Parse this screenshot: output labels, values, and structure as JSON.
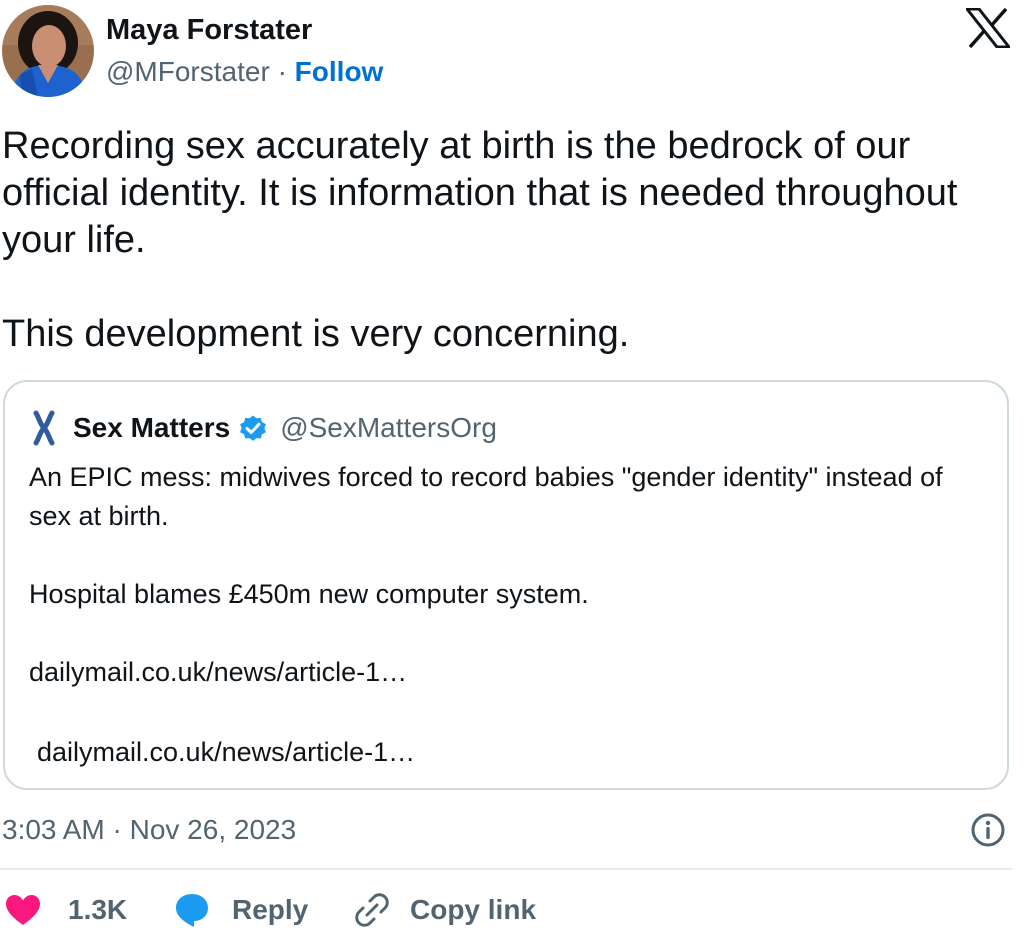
{
  "author": {
    "name": "Maya Forstater",
    "handle": "@MForstater",
    "separator": "·",
    "follow_label": "Follow"
  },
  "tweet": {
    "paragraphs": [
      "Recording sex accurately at birth is the bedrock of our official identity. It is information that is needed throughout your life.",
      "This development is very concerning."
    ]
  },
  "quoted_tweet": {
    "name": "Sex Matters",
    "handle": "@SexMattersOrg",
    "verified": true,
    "paragraphs": [
      "An EPIC mess: midwives forced to record babies \"gender identity\" instead of sex at birth.",
      "Hospital blames £450m new computer system.",
      "dailymail.co.uk/news/article-1…"
    ],
    "link_preview": "dailymail.co.uk/news/article-1…"
  },
  "timestamp": "3:03 AM · Nov 26, 2023",
  "actions": {
    "like_count": "1.3K",
    "reply_label": "Reply",
    "copy_link_label": "Copy link"
  },
  "icons": {
    "brand": "x-logo-icon",
    "info": "info-icon",
    "like": "heart-icon",
    "reply": "speech-bubble-icon",
    "copy": "link-icon",
    "verified": "verified-badge-icon"
  },
  "colors": {
    "follow_link": "#006fd6",
    "like_heart": "#f91880",
    "reply_bubble": "#1d9bf0",
    "verified_badge": "#1d9bf0",
    "muted_text": "#536471",
    "card_border": "#cfd9de"
  }
}
